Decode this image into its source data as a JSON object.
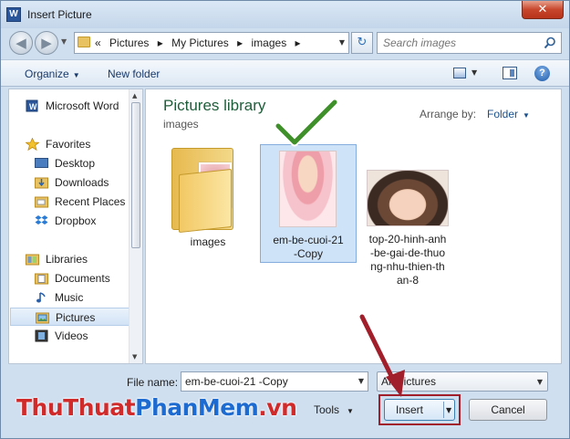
{
  "window": {
    "title": "Insert Picture",
    "app_icon_letter": "W",
    "close_glyph": "✕"
  },
  "nav": {
    "back_glyph": "◀",
    "forward_glyph": "▶",
    "breadcrumb_prefix": "«",
    "breadcrumb": [
      "Pictures",
      "My Pictures",
      "images"
    ],
    "breadcrumb_separator": "▸",
    "refresh_glyph": "↻",
    "search_placeholder": "Search images"
  },
  "toolbar": {
    "organize_label": "Organize",
    "new_folder_label": "New folder",
    "help_label": "?"
  },
  "sidebar": {
    "items": [
      {
        "label": "Microsoft Word",
        "icon": "word-doc-icon"
      },
      {
        "label": "Favorites",
        "icon": "star-icon"
      },
      {
        "label": "Desktop",
        "icon": "desktop-icon"
      },
      {
        "label": "Downloads",
        "icon": "downloads-folder-icon"
      },
      {
        "label": "Recent Places",
        "icon": "recent-places-icon"
      },
      {
        "label": "Dropbox",
        "icon": "dropbox-icon"
      },
      {
        "label": "Libraries",
        "icon": "libraries-icon"
      },
      {
        "label": "Documents",
        "icon": "documents-icon"
      },
      {
        "label": "Music",
        "icon": "music-note-icon"
      },
      {
        "label": "Pictures",
        "icon": "pictures-icon",
        "selected": true
      },
      {
        "label": "Videos",
        "icon": "video-film-icon"
      }
    ]
  },
  "content": {
    "library_title": "Pictures library",
    "library_subtitle": "images",
    "arrange_label": "Arrange by:",
    "arrange_value": "Folder",
    "files": [
      {
        "name_lines": [
          "images"
        ],
        "type": "folder"
      },
      {
        "name_lines": [
          "em-be-cuoi-21",
          "-Copy"
        ],
        "type": "image",
        "selected": true
      },
      {
        "name_lines": [
          "top-20-hinh-anh",
          "-be-gai-de-thuo",
          "ng-nhu-thien-th",
          "an-8"
        ],
        "type": "image"
      }
    ]
  },
  "footer": {
    "file_name_label": "File name:",
    "file_name_value": "em-be-cuoi-21 -Copy",
    "file_type_value": "All Pictures",
    "tools_label": "Tools",
    "insert_label": "Insert",
    "cancel_label": "Cancel"
  },
  "watermark": {
    "part1": "ThuThuat",
    "part2": "PhanMem",
    "part3": ".vn"
  },
  "colors": {
    "library_title": "#1e5d3a",
    "annotation_red": "#a11f2a",
    "checkmark_green": "#3f8f2a",
    "selection_blue": "#cfe3f8"
  }
}
